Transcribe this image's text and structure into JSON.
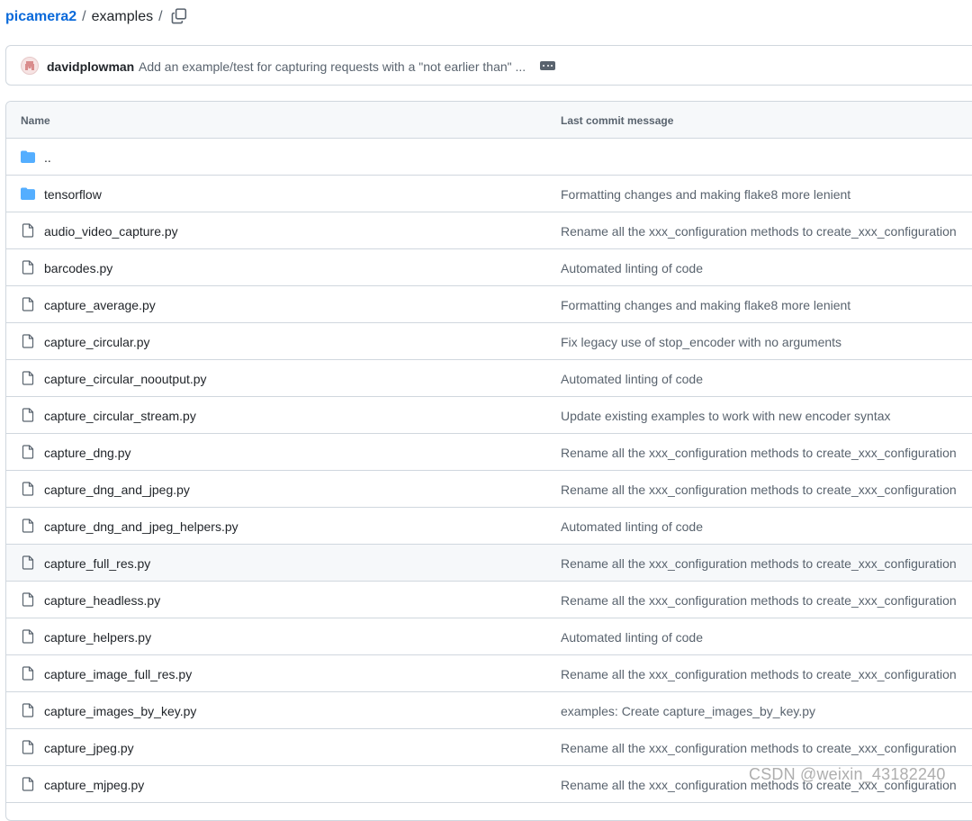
{
  "breadcrumb": {
    "repo": "picamera2",
    "separator": "/",
    "folder": "examples",
    "trailing_separator": "/"
  },
  "commit": {
    "author": "davidplowman",
    "message": "Add an example/test for capturing requests with a \"not earlier than\" ..."
  },
  "table": {
    "headers": {
      "name": "Name",
      "last_commit_message": "Last commit message"
    },
    "rows": [
      {
        "type": "folder",
        "name": "..",
        "message": ""
      },
      {
        "type": "folder",
        "name": "tensorflow",
        "message": "Formatting changes and making flake8 more lenient"
      },
      {
        "type": "file",
        "name": "audio_video_capture.py",
        "message": "Rename all the xxx_configuration methods to create_xxx_configuration"
      },
      {
        "type": "file",
        "name": "barcodes.py",
        "message": "Automated linting of code"
      },
      {
        "type": "file",
        "name": "capture_average.py",
        "message": "Formatting changes and making flake8 more lenient"
      },
      {
        "type": "file",
        "name": "capture_circular.py",
        "message": "Fix legacy use of stop_encoder with no arguments"
      },
      {
        "type": "file",
        "name": "capture_circular_nooutput.py",
        "message": "Automated linting of code"
      },
      {
        "type": "file",
        "name": "capture_circular_stream.py",
        "message": "Update existing examples to work with new encoder syntax"
      },
      {
        "type": "file",
        "name": "capture_dng.py",
        "message": "Rename all the xxx_configuration methods to create_xxx_configuration"
      },
      {
        "type": "file",
        "name": "capture_dng_and_jpeg.py",
        "message": "Rename all the xxx_configuration methods to create_xxx_configuration"
      },
      {
        "type": "file",
        "name": "capture_dng_and_jpeg_helpers.py",
        "message": "Automated linting of code"
      },
      {
        "type": "file",
        "name": "capture_full_res.py",
        "message": "Rename all the xxx_configuration methods to create_xxx_configuration",
        "highlighted": true
      },
      {
        "type": "file",
        "name": "capture_headless.py",
        "message": "Rename all the xxx_configuration methods to create_xxx_configuration"
      },
      {
        "type": "file",
        "name": "capture_helpers.py",
        "message": "Automated linting of code"
      },
      {
        "type": "file",
        "name": "capture_image_full_res.py",
        "message": "Rename all the xxx_configuration methods to create_xxx_configuration"
      },
      {
        "type": "file",
        "name": "capture_images_by_key.py",
        "message": "examples: Create capture_images_by_key.py"
      },
      {
        "type": "file",
        "name": "capture_jpeg.py",
        "message": "Rename all the xxx_configuration methods to create_xxx_configuration"
      },
      {
        "type": "file",
        "name": "capture_mjpeg.py",
        "message": "Rename all the xxx_configuration methods to create_xxx_configuration"
      }
    ]
  },
  "watermark": "CSDN @weixin_43182240",
  "colors": {
    "link": "#0969da",
    "folder_icon": "#54aeff",
    "muted_text": "#59636e",
    "border": "#d0d7de",
    "header_bg": "#f6f8fa"
  }
}
